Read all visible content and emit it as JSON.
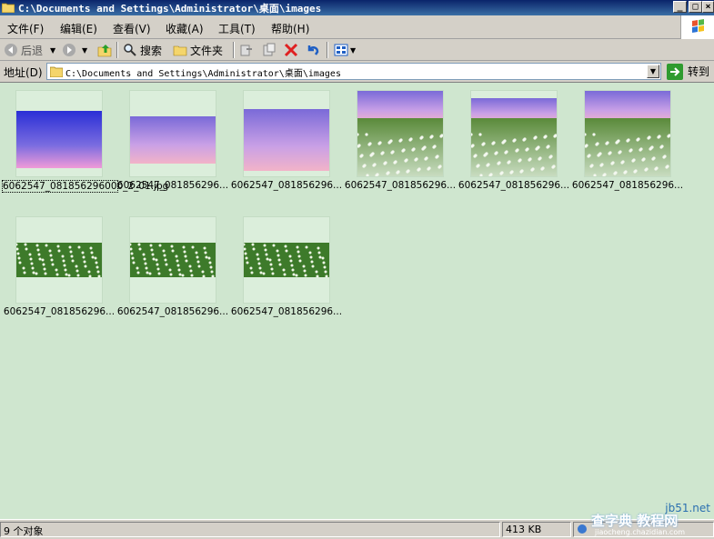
{
  "window": {
    "title": "C:\\Documents and Settings\\Administrator\\桌面\\images",
    "minimize_label": "_",
    "close_label": "×"
  },
  "menu": {
    "items": [
      "文件(F)",
      "编辑(E)",
      "查看(V)",
      "收藏(A)",
      "工具(T)",
      "帮助(H)"
    ]
  },
  "toolbar": {
    "back_label": "后退",
    "search_label": "搜索",
    "folders_label": "文件夹"
  },
  "address": {
    "label": "地址(D)",
    "path": "C:\\Documents and Settings\\Administrator\\桌面\\images",
    "go_label": "转到"
  },
  "files": [
    {
      "name": "6062547_081856296000_2_01.jpg",
      "thumb": "sky-gradient",
      "selected": true
    },
    {
      "name": "6062547_081856296...",
      "thumb": "sky-gradient"
    },
    {
      "name": "6062547_081856296...",
      "thumb": "sky-gradient"
    },
    {
      "name": "6062547_081856296...",
      "thumb": "flower-field"
    },
    {
      "name": "6062547_081856296...",
      "thumb": "flower-field"
    },
    {
      "name": "6062547_081856296...",
      "thumb": "flower-field"
    },
    {
      "name": "6062547_081856296...",
      "thumb": "flower-strip"
    },
    {
      "name": "6062547_081856296...",
      "thumb": "flower-strip"
    },
    {
      "name": "6062547_081856296...",
      "thumb": "flower-strip"
    }
  ],
  "status": {
    "count": "9 个对象",
    "size": "413 KB"
  },
  "watermark": {
    "site": "jb51.net",
    "text": "查字典 教程网",
    "url": "jiaocheng.chazidian.com"
  }
}
